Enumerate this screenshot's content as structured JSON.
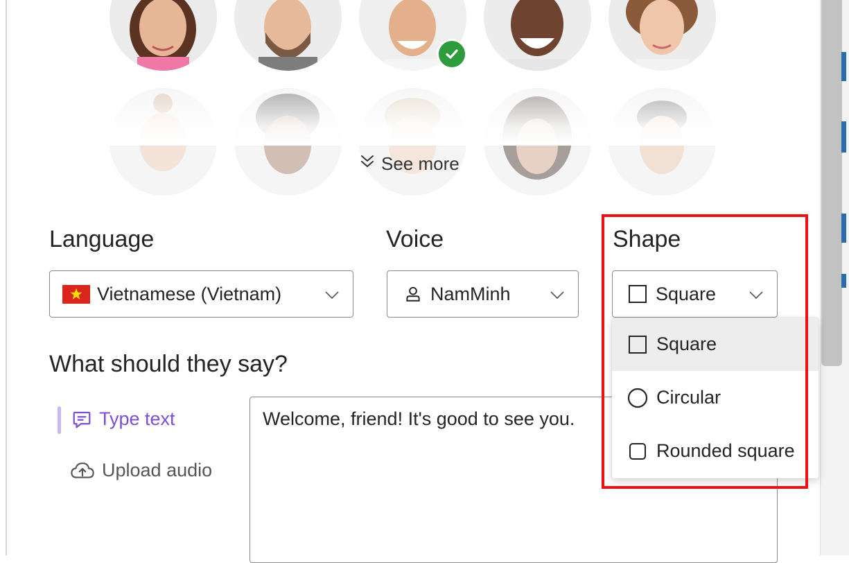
{
  "avatars": {
    "row1": [
      "avatar-woman-1",
      "avatar-man-beard",
      "avatar-man-selected",
      "avatar-man-smiling",
      "avatar-woman-curly"
    ],
    "row2": [
      "avatar-woman-bun",
      "avatar-man-curly",
      "avatar-man-blond",
      "avatar-woman-dark-hair",
      "avatar-man-short-hair"
    ]
  },
  "see_more": {
    "label": "See more",
    "icon": "double-chevron-down-icon"
  },
  "language": {
    "label": "Language",
    "value": "Vietnamese (Vietnam)",
    "flag": "vietnam-flag"
  },
  "voice": {
    "label": "Voice",
    "value": "NamMinh",
    "icon": "person-icon"
  },
  "shape": {
    "label": "Shape",
    "value": "Square",
    "options": [
      {
        "label": "Square",
        "icon": "square-icon"
      },
      {
        "label": "Circular",
        "icon": "circle-icon"
      },
      {
        "label": "Rounded square",
        "icon": "rounded-square-icon"
      }
    ]
  },
  "say": {
    "heading": "What should they say?",
    "tabs": [
      {
        "label": "Type text",
        "icon": "chat-text-icon"
      },
      {
        "label": "Upload audio",
        "icon": "cloud-upload-icon"
      }
    ],
    "text": "Welcome, friend! It's good to see you."
  },
  "colors": {
    "accent": "#7b4fd6",
    "check": "#2e9b3c",
    "highlight": "#ee1111"
  }
}
